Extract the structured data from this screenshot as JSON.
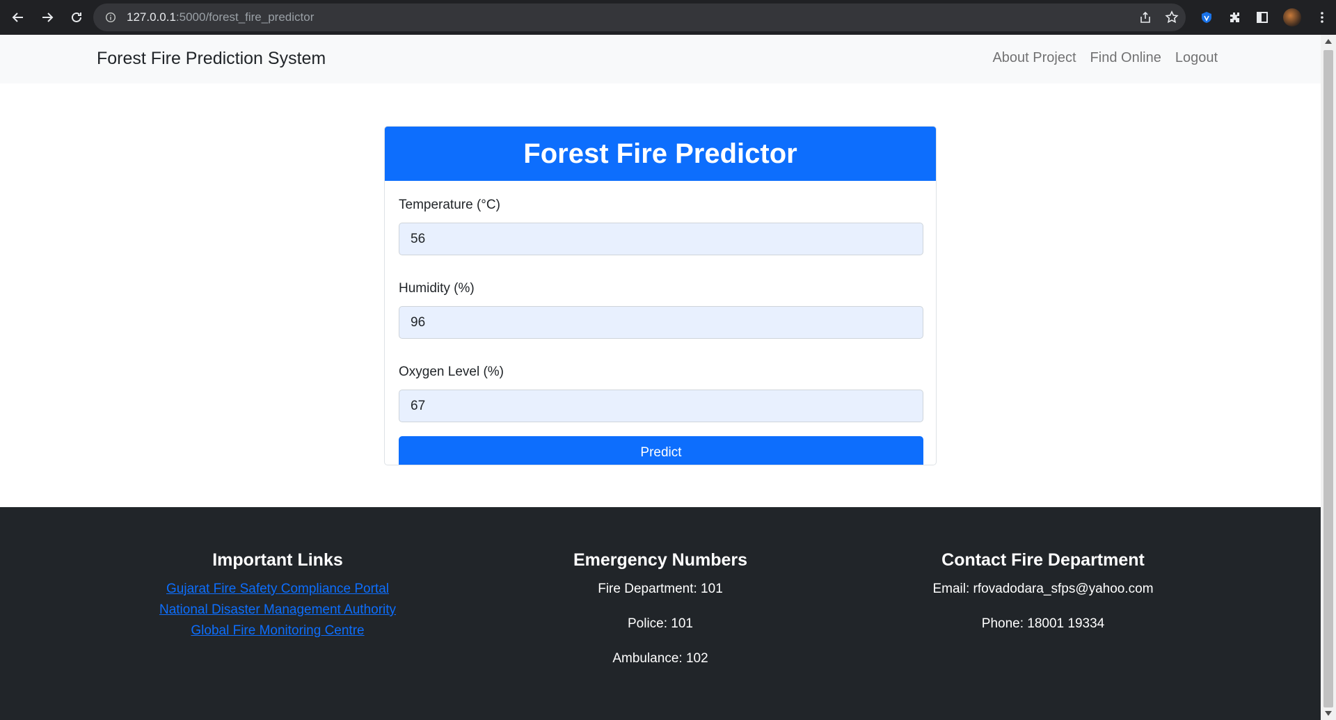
{
  "browser": {
    "url_host": "127.0.0.1",
    "url_path": ":5000/forest_fire_predictor"
  },
  "navbar": {
    "brand": "Forest Fire Prediction System",
    "links": [
      "About Project",
      "Find Online",
      "Logout"
    ]
  },
  "form": {
    "title": "Forest Fire Predictor",
    "temperature_label": "Temperature (°C)",
    "temperature_value": "56",
    "humidity_label": "Humidity (%)",
    "humidity_value": "96",
    "oxygen_label": "Oxygen Level (%)",
    "oxygen_value": "67",
    "predict_label": "Predict"
  },
  "footer": {
    "links_title": "Important Links",
    "links": [
      "Gujarat Fire Safety Compliance Portal",
      "National Disaster Management Authority",
      "Global Fire Monitoring Centre"
    ],
    "emergency_title": "Emergency Numbers",
    "emergency": [
      "Fire Department: 101",
      "Police: 101",
      "Ambulance: 102"
    ],
    "contact_title": "Contact Fire Department",
    "contact": [
      "Email: rfovadodara_sfps@yahoo.com",
      "Phone: 18001 19334"
    ]
  },
  "colors": {
    "primary": "#0d6efd",
    "footer_bg": "#212529",
    "navbar_bg": "#f8f9fa"
  }
}
